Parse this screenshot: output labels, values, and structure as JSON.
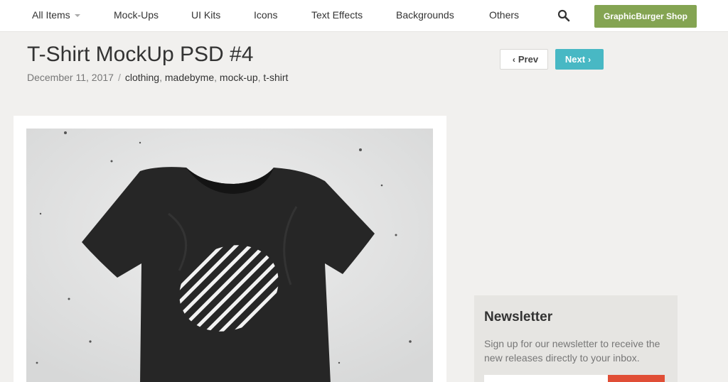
{
  "nav": {
    "items": [
      {
        "label": "All Items"
      },
      {
        "label": "Mock-Ups"
      },
      {
        "label": "UI Kits"
      },
      {
        "label": "Icons"
      },
      {
        "label": "Text Effects"
      },
      {
        "label": "Backgrounds"
      },
      {
        "label": "Others"
      }
    ],
    "search_icon": "search-icon",
    "shop_label": "GraphicBurger Shop"
  },
  "post": {
    "title": "T-Shirt MockUp PSD #4",
    "date": "December 11, 2017",
    "separator": "/",
    "tags": [
      "clothing",
      "madebyme",
      "mock-up",
      "t-shirt"
    ]
  },
  "pager": {
    "prev_label": "Prev",
    "next_label": "Next"
  },
  "newsletter": {
    "title": "Newsletter",
    "text": "Sign up for our newsletter to receive the new releases directly to your inbox."
  },
  "colors": {
    "shop": "#84a452",
    "next": "#48b8c4",
    "subscribe": "#e04e36",
    "background": "#f1f0ee"
  }
}
